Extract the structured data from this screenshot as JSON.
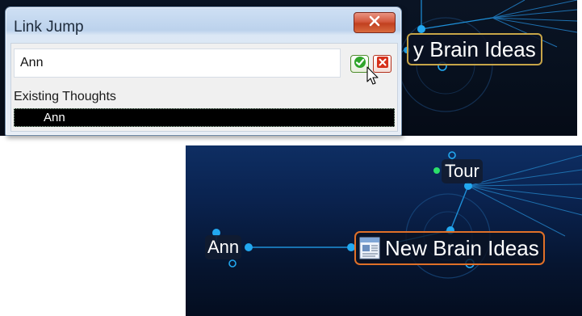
{
  "dialog": {
    "title": "Link Jump",
    "search_value": "Ann",
    "search_placeholder": "",
    "existing_label": "Existing Thoughts",
    "results": [
      "Ann"
    ]
  },
  "top_view": {
    "active_thought_partial": "y Brain Ideas"
  },
  "bottom_view": {
    "thoughts": {
      "tour": "Tour",
      "ann": "Ann",
      "active": "New Brain Ideas"
    }
  },
  "colors": {
    "canvas_top": "#07101e",
    "canvas_bottom": "#0a2350",
    "link_line": "#1e8fd8",
    "node_dot": "#22a8f0",
    "active_border": "#e07028",
    "top_active_border": "#c7a548",
    "close_button": "#d4593e"
  },
  "icons": {
    "close": "close-icon",
    "ok": "checkmark-icon",
    "cancel": "cancel-icon",
    "note": "note-document-icon",
    "cursor": "mouse-pointer-icon"
  }
}
